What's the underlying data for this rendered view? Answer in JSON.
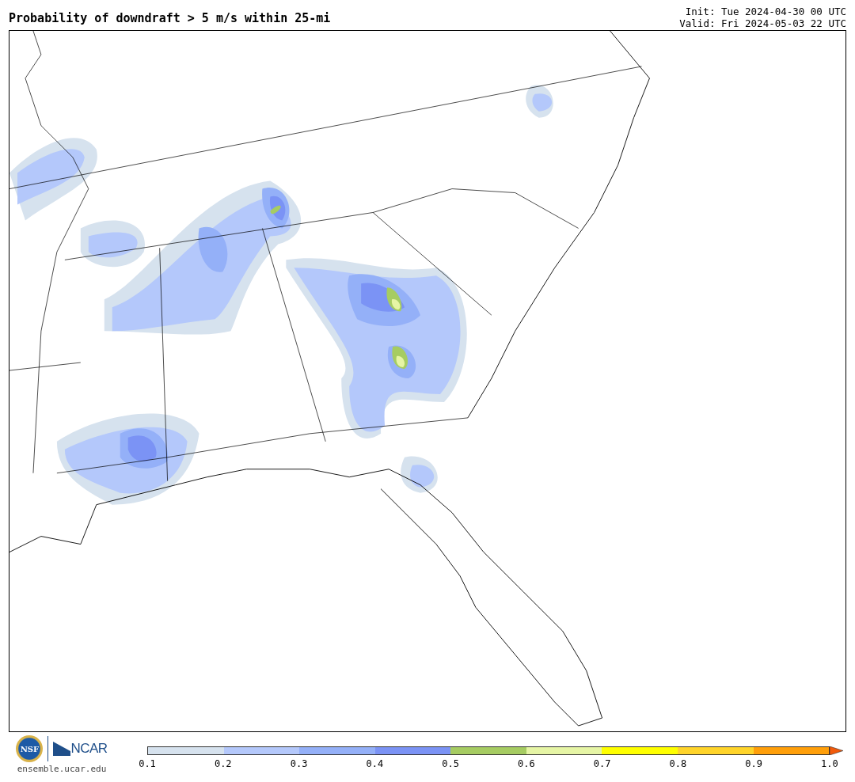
{
  "title": "Probability of downdraft > 5 m/s within 25-mi",
  "init": "Init: Tue 2024-04-30 00 UTC",
  "valid": "Valid: Fri 2024-05-03 22 UTC",
  "logos": {
    "seal": "NSF",
    "brand": "NCAR",
    "site": "ensemble.ucar.edu"
  },
  "colorbar": {
    "segments": [
      {
        "color": "#d6e2ee"
      },
      {
        "color": "#b4c8fb"
      },
      {
        "color": "#94b0f8"
      },
      {
        "color": "#7b93f5"
      },
      {
        "color": "#a6cc62"
      },
      {
        "color": "#e6f5a5"
      },
      {
        "color": "#ffff00"
      },
      {
        "color": "#ffd42a"
      },
      {
        "color": "#ff9f0a"
      },
      {
        "color": "#f25a0a",
        "kind": "arrow"
      }
    ],
    "ticks": [
      "0.1",
      "0.2",
      "0.3",
      "0.4",
      "0.5",
      "0.6",
      "0.7",
      "0.8",
      "0.9",
      "1.0"
    ]
  }
}
